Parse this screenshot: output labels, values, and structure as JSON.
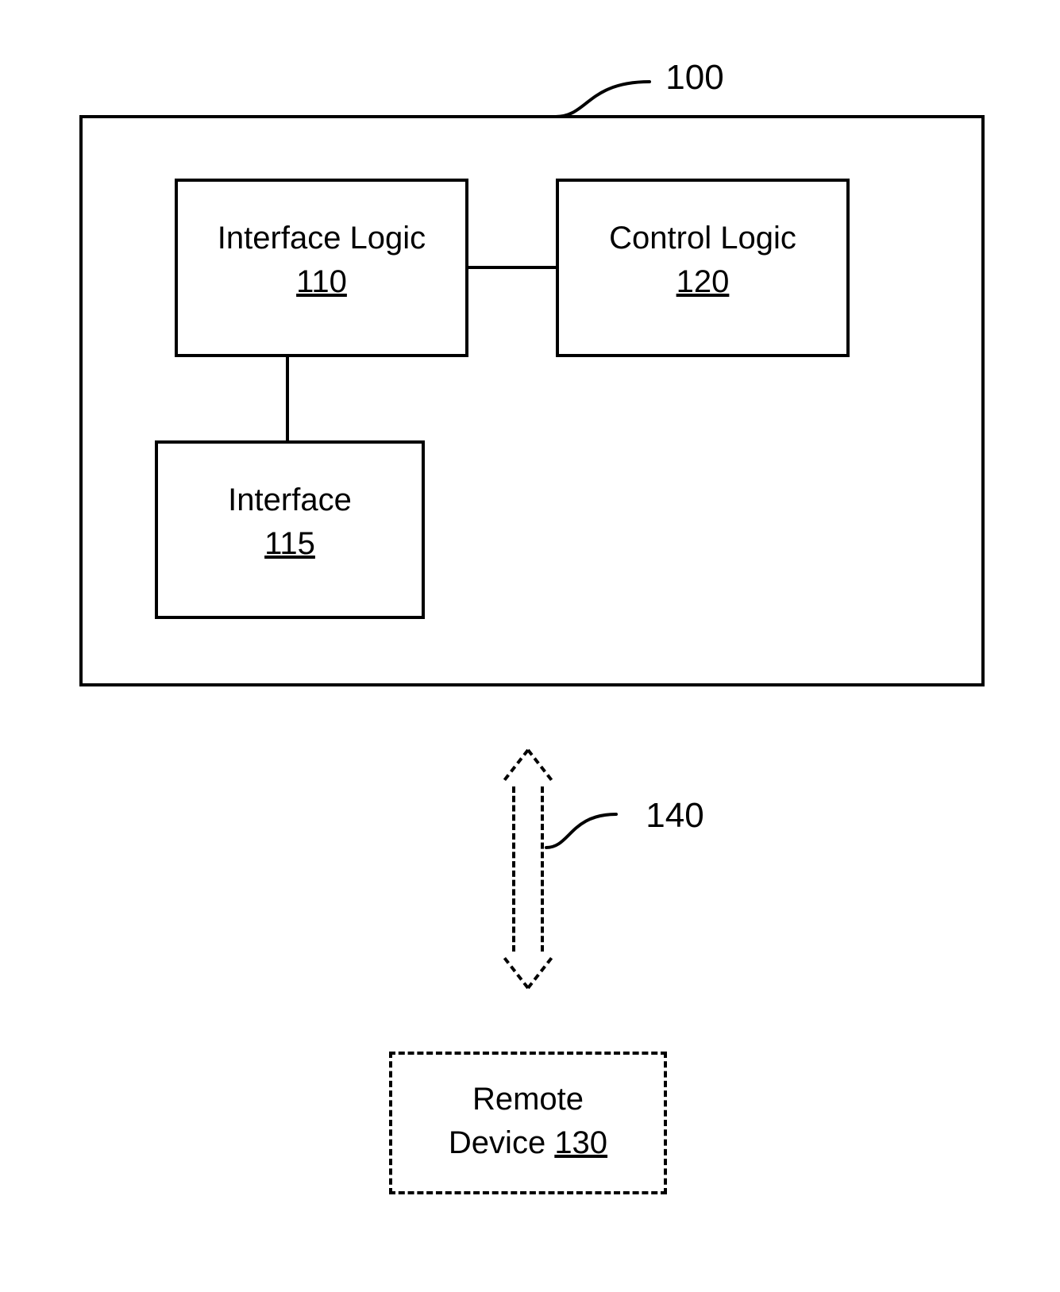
{
  "labels": {
    "outer_ref": "100",
    "interface_logic_title": "Interface Logic",
    "interface_logic_ref": "110",
    "control_logic_title": "Control Logic",
    "control_logic_ref": "120",
    "interface_title": "Interface",
    "interface_ref": "115",
    "arrow_ref": "140",
    "remote_line1": "Remote",
    "remote_line2_prefix": "Device ",
    "remote_ref": "130"
  }
}
